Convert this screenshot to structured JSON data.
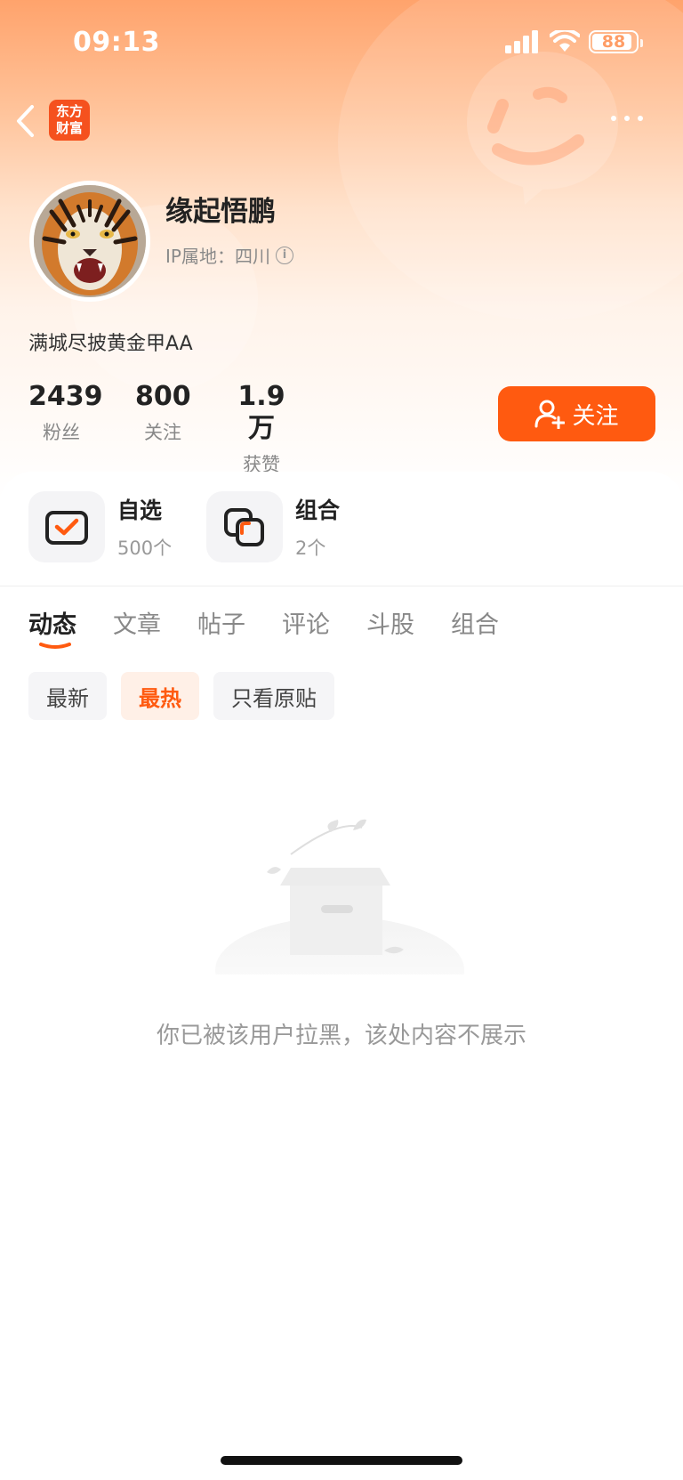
{
  "status_bar": {
    "time": "09:13",
    "battery": "88"
  },
  "nav": {
    "logo_line1": "东方",
    "logo_line2": "财富"
  },
  "profile": {
    "username": "缘起悟鹏",
    "ip_location": "IP属地：四川",
    "bio": "满城尽披黄金甲AA"
  },
  "stats": [
    {
      "value": "2439",
      "label": "粉丝"
    },
    {
      "value": "800",
      "label": "关注"
    },
    {
      "value": "1.9万",
      "label": "获赞"
    }
  ],
  "follow_button": {
    "label": "关注"
  },
  "quick_links": [
    {
      "title": "自选",
      "sub": "500个",
      "icon": "checkbox-icon"
    },
    {
      "title": "组合",
      "sub": "2个",
      "icon": "portfolio-icon"
    }
  ],
  "tabs": [
    "动态",
    "文章",
    "帖子",
    "评论",
    "斗股",
    "组合"
  ],
  "filters": [
    "最新",
    "最热",
    "只看原贴"
  ],
  "empty_state": {
    "message": "你已被该用户拉黑，该处内容不展示"
  },
  "colors": {
    "accent": "#ff5a10",
    "header_gradient_top": "#ffa36c"
  }
}
